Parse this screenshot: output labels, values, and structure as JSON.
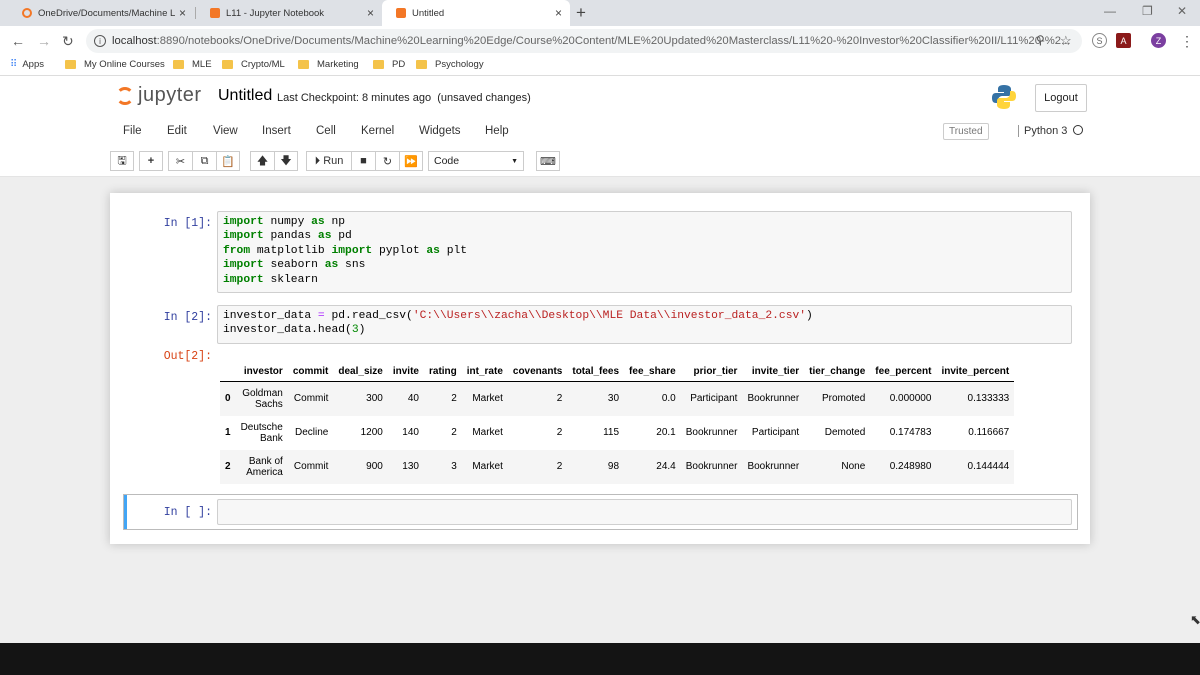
{
  "browser": {
    "tabs": [
      {
        "title": "OneDrive/Documents/Machine L",
        "close": "×"
      },
      {
        "title": "L11 - Jupyter Notebook",
        "close": "×"
      },
      {
        "title": "Untitled",
        "close": "×"
      }
    ],
    "new_tab": "+",
    "url_host": "localhost",
    "url_path": ":8890/notebooks/OneDrive/Documents/Machine%20Learning%20Edge/Course%20Content/MLE%20Updated%20Masterclass/L11%20-%20Investor%20Classifier%20II/L11%20-%2...",
    "profile_initial": "Z",
    "bookmarks": [
      "Apps",
      "My Online Courses",
      "MLE",
      "Crypto/ML",
      "Marketing",
      "PD",
      "Psychology"
    ]
  },
  "jupyter": {
    "logo_text": "jupyter",
    "notebook_name": "Untitled",
    "checkpoint": "Last Checkpoint: 8 minutes ago",
    "unsaved": "(unsaved changes)",
    "logout": "Logout",
    "menus": [
      "File",
      "Edit",
      "View",
      "Insert",
      "Cell",
      "Kernel",
      "Widgets",
      "Help"
    ],
    "trusted": "Trusted",
    "kernel_name": "Python 3",
    "run_label": "Run",
    "cell_type": "Code"
  },
  "cells": [
    {
      "prompt": "In [1]:"
    },
    {
      "prompt": "In [2]:",
      "out_prompt": "Out[2]:"
    },
    {
      "prompt": "In [ ]:"
    }
  ],
  "code1": {
    "line1_kw": "import",
    "line1_a": " numpy ",
    "line1_as": "as",
    "line1_b": " np",
    "line2_kw": "import",
    "line2_a": " pandas ",
    "line2_as": "as",
    "line2_b": " pd",
    "line3_kw": "from",
    "line3_a": " matplotlib ",
    "line3_imp": "import",
    "line3_b": " pyplot ",
    "line3_as": "as",
    "line3_c": " plt",
    "line4_kw": "import",
    "line4_a": " seaborn ",
    "line4_as": "as",
    "line4_b": " sns",
    "line5_kw": "import",
    "line5_a": " sklearn"
  },
  "code2": {
    "a": "investor_data ",
    "eq": "=",
    "b": " pd.read_csv(",
    "path": "'C:\\\\Users\\\\zacha\\\\Desktop\\\\MLE Data\\\\investor_data_2.csv'",
    "c": ")",
    "d": "investor_data.head(",
    "n": "3",
    "e": ")"
  },
  "dataframe": {
    "columns": [
      "",
      "investor",
      "commit",
      "deal_size",
      "invite",
      "rating",
      "int_rate",
      "covenants",
      "total_fees",
      "fee_share",
      "prior_tier",
      "invite_tier",
      "tier_change",
      "fee_percent",
      "invite_percent"
    ],
    "rows": [
      [
        "0",
        "Goldman Sachs",
        "Commit",
        "300",
        "40",
        "2",
        "Market",
        "2",
        "30",
        "0.0",
        "Participant",
        "Bookrunner",
        "Promoted",
        "0.000000",
        "0.133333"
      ],
      [
        "1",
        "Deutsche Bank",
        "Decline",
        "1200",
        "140",
        "2",
        "Market",
        "2",
        "115",
        "20.1",
        "Bookrunner",
        "Participant",
        "Demoted",
        "0.174783",
        "0.116667"
      ],
      [
        "2",
        "Bank of America",
        "Commit",
        "900",
        "130",
        "3",
        "Market",
        "2",
        "98",
        "24.4",
        "Bookrunner",
        "Bookrunner",
        "None",
        "0.248980",
        "0.144444"
      ]
    ]
  }
}
